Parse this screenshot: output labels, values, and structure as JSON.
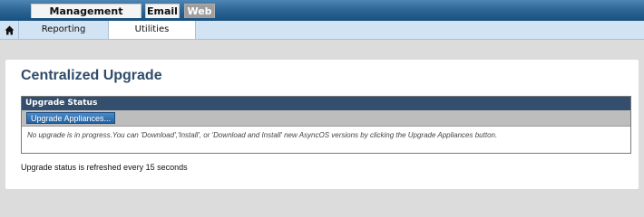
{
  "top_tabs": [
    {
      "label": "Management Appliance",
      "active": false
    },
    {
      "label": "Email",
      "active": false
    },
    {
      "label": "Web",
      "active": true
    }
  ],
  "nav": {
    "home_icon": "home-icon",
    "items": [
      {
        "label": "Reporting",
        "selected": false
      },
      {
        "label": "Utilities",
        "selected": true
      }
    ]
  },
  "page": {
    "title": "Centralized Upgrade",
    "status_section": {
      "header": "Upgrade Status",
      "button_label": "Upgrade Appliances...",
      "message": "No upgrade is in progress.You can 'Download','Install', or 'Download and Install' new AsyncOS versions by clicking the Upgrade Appliances button."
    },
    "refresh_note": "Upgrade status is refreshed every 15 seconds"
  },
  "colors": {
    "top_bar": "#2f6797",
    "nav_bar": "#d2e3f3",
    "section_header": "#344e6d",
    "title": "#2f4c6b"
  }
}
